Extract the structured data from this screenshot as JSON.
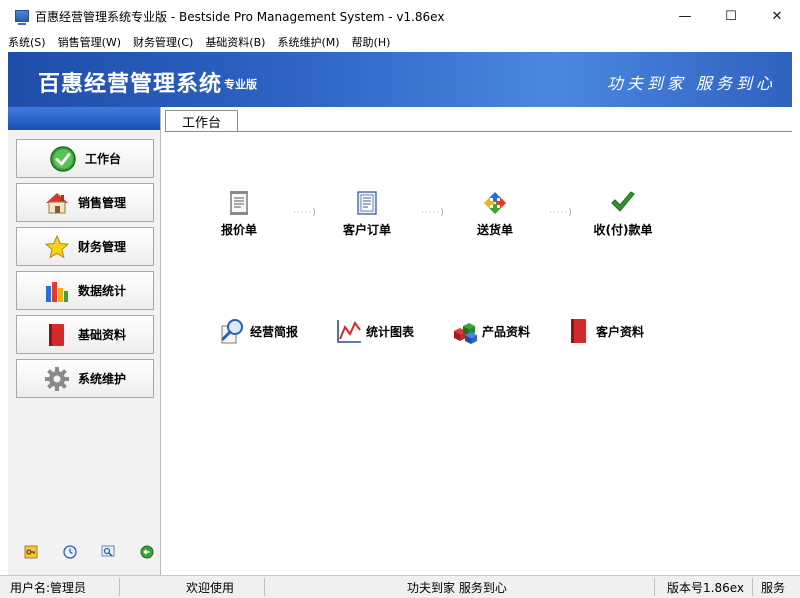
{
  "window": {
    "title": "百惠经营管理系统专业版 - Bestside Pro Management System - v1.86ex",
    "minimize": "—",
    "maximize": "☐",
    "close": "✕"
  },
  "menu": [
    {
      "label": "系统(S)"
    },
    {
      "label": "销售管理(W)"
    },
    {
      "label": "财务管理(C)"
    },
    {
      "label": "基础资料(B)"
    },
    {
      "label": "系统维护(M)"
    },
    {
      "label": "帮助(H)"
    }
  ],
  "banner": {
    "title": "百惠经营管理系统",
    "subtitle": "专业版",
    "slogan": "功夫到家 服务到心"
  },
  "sidebar": {
    "items": [
      {
        "label": "工作台",
        "icon": "check-circle-icon",
        "active": true
      },
      {
        "label": "销售管理",
        "icon": "house-icon"
      },
      {
        "label": "财务管理",
        "icon": "star-icon"
      },
      {
        "label": "数据统计",
        "icon": "bar-chart-icon"
      },
      {
        "label": "基础资料",
        "icon": "red-book-icon"
      },
      {
        "label": "系统维护",
        "icon": "gear-icon"
      }
    ],
    "tools": [
      "key-icon",
      "clock-icon",
      "search-icon",
      "exit-icon"
    ]
  },
  "main": {
    "tab": "工作台",
    "flow": [
      {
        "label": "报价单",
        "icon": "document-icon"
      },
      {
        "label": "客户订单",
        "icon": "order-icon"
      },
      {
        "label": "送货单",
        "icon": "recycle-icon"
      },
      {
        "label": "收(付)款单",
        "icon": "checkmark-icon"
      }
    ],
    "flow_separator": "·····)",
    "quick": [
      {
        "label": "经营简报",
        "icon": "magnifier-icon"
      },
      {
        "label": "统计图表",
        "icon": "line-chart-icon"
      },
      {
        "label": "产品资料",
        "icon": "cubes-icon"
      },
      {
        "label": "客户资料",
        "icon": "red-book-icon"
      }
    ]
  },
  "status": {
    "user": "用户名:管理员",
    "welcome": "欢迎使用",
    "slogan": "功夫到家 服务到心",
    "version": "版本号1.86ex",
    "service": "服务"
  },
  "colors": {
    "banner_dark": "#1f4ea8",
    "banner_light": "#4a88e0",
    "sidebar_bg": "#f2f2f2"
  }
}
